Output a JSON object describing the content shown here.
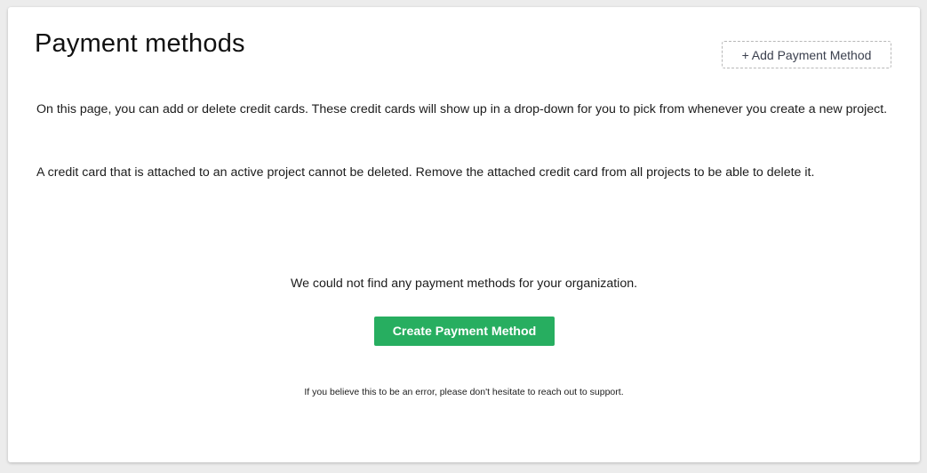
{
  "header": {
    "title": "Payment methods",
    "add_button": {
      "icon": "plus-icon",
      "icon_glyph": "+",
      "label": "Add Payment Method"
    }
  },
  "intro": {
    "paragraph_1": "On this page, you can add or delete credit cards. These credit cards will show up in a drop-down for you to pick from whenever you create a new project.",
    "paragraph_2": "A credit card that is attached to an active project cannot be deleted. Remove the attached credit card from all projects to be able to delete it."
  },
  "empty_state": {
    "message": "We could not find any payment methods for your organization.",
    "create_button_label": "Create Payment Method",
    "support_note": "If you believe this to be an error, please don't hesitate to reach out to support."
  },
  "colors": {
    "primary_button": "#27ae60",
    "background": "#ececec",
    "card": "#ffffff"
  }
}
